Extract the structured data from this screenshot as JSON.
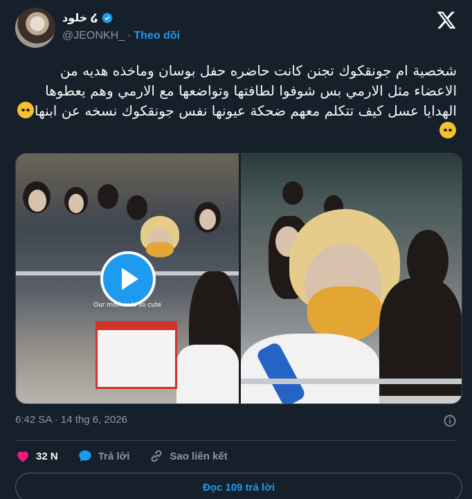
{
  "author": {
    "display_name": "خلود ໒",
    "handle": "@JEONKH_",
    "separator": "·",
    "follow_label": "Theo dõi"
  },
  "tweet": {
    "text": "شخصية ام جونقكوك تجنن كانت حاضره حفل بوسان وماخذه هديه من الاعضاء مثل الارمي بس شوفوا لطافتها وتواضعها مع الارمي وهم يعطوها الهدايا عسل كيف تتكلم معهم ضحكة عيونها نفس جونقكوك نسخه عن ابنها"
  },
  "media": {
    "caption_overlay": "Our mother Is so cute"
  },
  "meta": {
    "timestamp": "6:42 SA · 14 thg 6, 2026"
  },
  "actions": {
    "likes_count": "32 N",
    "reply_label": "Trả lời",
    "copy_link_label": "Sao liên kết"
  },
  "footer": {
    "read_replies_label": "Đọc 109 trả lời"
  },
  "colors": {
    "background": "#15202b",
    "accent": "#1d9bf0",
    "like": "#f91880",
    "muted": "#8b98a5"
  },
  "icons": [
    "verified-badge-icon",
    "x-logo-icon",
    "play-icon",
    "info-icon",
    "heart-icon",
    "reply-icon",
    "link-icon"
  ]
}
